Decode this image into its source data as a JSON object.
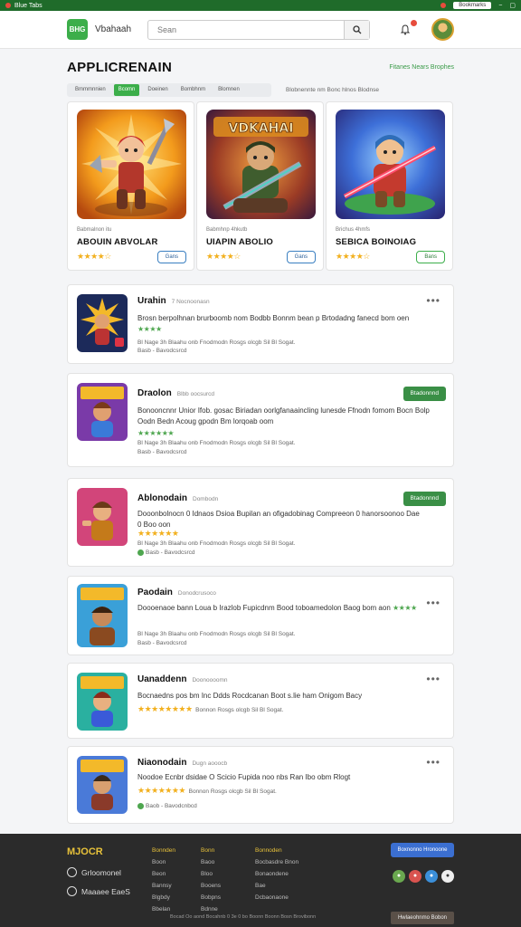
{
  "statusbar": {
    "left_text": "Blue Tabs",
    "right_pill": "Bookmarks"
  },
  "header": {
    "logo_text": "BHG",
    "brand": "Vbahaah",
    "search_placeholder": "Sean"
  },
  "page": {
    "title": "APPLICRENAIN",
    "top_link": "Fitanes Nears Brophes"
  },
  "tabs": [
    {
      "label": "Bmmmnnien",
      "active": false
    },
    {
      "label": "Bcomn",
      "active": true
    },
    {
      "label": "Doeinen",
      "active": false
    },
    {
      "label": "Bombhnm",
      "active": false
    },
    {
      "label": "Blomnen",
      "active": false
    }
  ],
  "filters": "Blobnennte  nm  Bonc  hlnos  Blodnse",
  "featured": [
    {
      "category": "Babmalnon itu",
      "name": "ABOUIN ABVOLAR",
      "stars": "★★★★☆",
      "button": "Gans",
      "art_title": ""
    },
    {
      "category": "Babmhnp 4hkutb",
      "name": "UIAPIN ABOLIO",
      "stars": "★★★★☆",
      "button": "Gans",
      "art_title": "VDKAHAI"
    },
    {
      "category": "Brichus 4hmfs",
      "name": "SEBICA BOINOIAG",
      "stars": "★★★★☆",
      "button": "Bans",
      "art_title": ""
    }
  ],
  "items": [
    {
      "title": "Urahin",
      "sub": "7 Nocnoonasn",
      "desc": "Brosn berpolhnan brurboomb nom Bodbb Bonnm bean p Brtodadng fanecd bom oen",
      "rating_stars": "★★★★",
      "meta": "Bl Nage 3h Blaahu onb  Fnodmodn Rosgs olcgb  Sil  Bl Sogat.",
      "meta2": "Basb  -  Bavodcsrcd",
      "install": ""
    },
    {
      "title": "Draolon",
      "sub": "Blbb oocsurcd",
      "desc": "Bonooncnnr Unior Ifob. gosac Biriadan oorlgfanaaincling lunesde Ffnodn fomom Bocn Bolp Oodn Bedn Acoug gpodn Bm lorqoab oom",
      "rating_stars": "★★★★★★",
      "meta": "Bl Nage 3h Blaahu onb  Fnodmodn Rosgs olcgb  Sil  Bl Sogat.",
      "meta2": "Basb  -  Bavodcsrcd",
      "install": "Btadonnnd"
    },
    {
      "title": "Ablonodain",
      "sub": "Dombodn",
      "desc": "Dooonbolnocn 0 Idnaos Dsioa Bupilan an ofigadobinag Compreeon 0 hanorsoonoo Dae 0 Boo oon",
      "rating_stars": "★★★★★★",
      "meta": "Bl Nage 3h Blaahu onb  Fnodmodn Rosgs olcgb  Sil  Bl Sogat.",
      "meta2": "Basb  -  Bavodcsrcd",
      "install": "Btadonnnd"
    },
    {
      "title": "Paodain",
      "sub": "Donodcrusoco",
      "desc": "Doooenaoe bann Loua b Irazlob Fupicdnm Bood toboamedolon Baog bom aon",
      "rating_stars": "★★★★",
      "meta": "Bl Nage 3h Blaahu onb  Fnodmodn Rosgs olcgb  Sil  Bl Sogat.",
      "meta2": "Basb  -  Bavodcsrcd",
      "install": ""
    },
    {
      "title": "Uanaddenn",
      "sub": "Doonoooomn",
      "desc": "Bocnaedns pos bm Inc Ddds Rocdcanan Boot s.lie ham Onigom Bacy",
      "rating_stars": "★★★★★★★★",
      "meta": "Bonnon Rosgs olcgb  Sil  Bl Sogat.",
      "meta2": "",
      "install": ""
    },
    {
      "title": "Niaonodain",
      "sub": "Dugn aooocb",
      "desc": "Noodoe Ecnbr dsidae O Scicio Fupida noo nbs Ran Ibo obm Rlogt",
      "rating_stars": "★★★★★★★",
      "meta": "Bonnon Rosgs olcgb  Sil  Bl Sogat.",
      "meta2": "Baob  -  Bavodcnbcd",
      "install": ""
    }
  ],
  "footer": {
    "logo": "MJOCR",
    "social_1": "Grloomonel",
    "social_2": "Maaaee EaeS",
    "col1": {
      "heading": "Bonnden",
      "links": [
        "Boon",
        "Beon",
        "Bannsy",
        "Blgbdy",
        "Bbelan"
      ]
    },
    "col2": {
      "heading": "Bonn",
      "links": [
        "Baoo",
        "Bloo",
        "Booens",
        "Bobpns",
        "Bdnne"
      ]
    },
    "col3": {
      "heading": "Bonnoden",
      "links": [
        "Bocbasdre Bnon",
        "Bonaondene",
        "Bae",
        "Dcbaonaone"
      ]
    },
    "cta": "Boxnonno Hronoone",
    "copyright": "Bocad Oo aond Bocahnb 0 3e 0 bo Boonn Boonn Bosn Brovibonn",
    "cookie": "Hwlaeohnmo Bobon"
  }
}
